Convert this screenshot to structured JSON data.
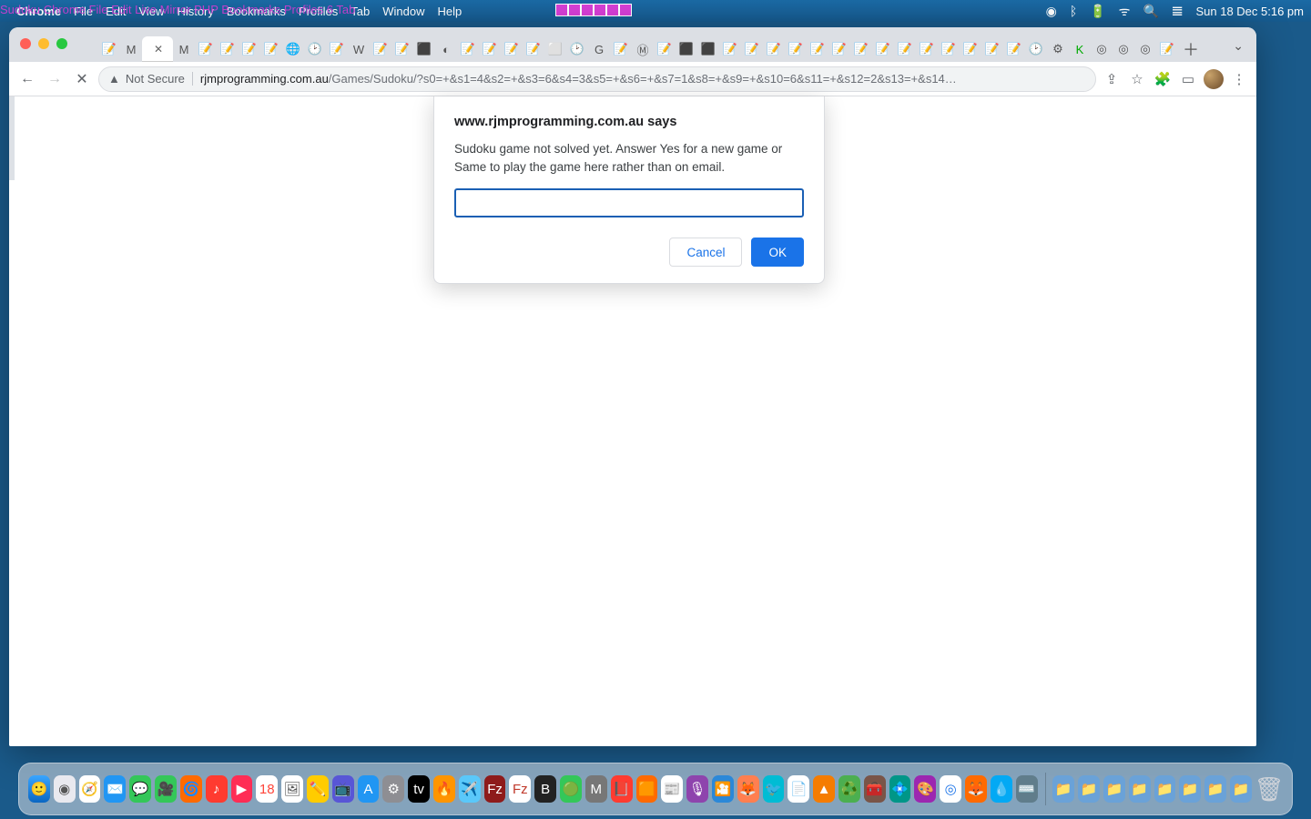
{
  "menubar": {
    "appname": "Chrome",
    "items": [
      "File",
      "Edit",
      "View",
      "History",
      "Bookmarks",
      "Profiles",
      "Tab",
      "Window",
      "Help"
    ],
    "bgtext": "Sudoku Chrome  File  Edit Live  Mirror PHP Bookmarks    Profiles  6 Tab",
    "clock": "Sun 18 Dec  5:16 pm"
  },
  "browser": {
    "not_secure": "Not Secure",
    "host": "rjmprogramming.com.au",
    "path": "/Games/Sudoku/?s0=+&s1=4&s2=+&s3=6&s4=3&s5=+&s6=+&s7=1&s8=+&s9=+&s10=6&s11=+&s12=2&s13=+&s14…",
    "profiles_badge": "6",
    "tabcount": 49
  },
  "dialog": {
    "title": "www.rjmprogramming.com.au says",
    "message": "Sudoku game not solved yet.  Answer Yes for a new game or Same to play the game here rather than on email.",
    "input_value": "",
    "cancel": "Cancel",
    "ok": "OK"
  },
  "dock": {
    "apps": [
      "finder",
      "launchpad",
      "safari",
      "mail",
      "messages",
      "maps",
      "photos",
      "facetime",
      "calendar",
      "contacts",
      "reminders",
      "notes",
      "tv",
      "music",
      "podcasts",
      "appstore",
      "settings",
      "terminal",
      "filezilla",
      "bbedit",
      "xcode",
      "textedit",
      "mamp",
      "word",
      "chrome",
      "wp",
      "zoom",
      "vlc",
      "podcasts2",
      "cyberduck",
      "diskutil",
      "audacity",
      "canva",
      "slack",
      "gimp",
      "firefox",
      "chrome2",
      "max",
      "steam",
      "pages",
      "numbers",
      "keynote",
      "folder1",
      "folder2",
      "folder3",
      "folder4",
      "folder5",
      "folder6",
      "trash"
    ]
  }
}
